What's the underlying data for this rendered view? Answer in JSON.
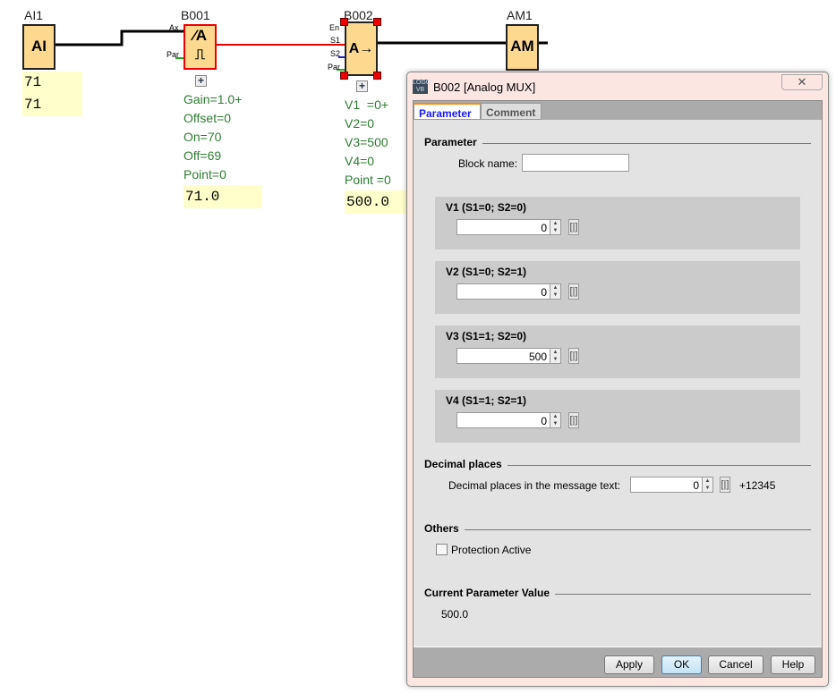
{
  "diagram": {
    "ai1": {
      "label": "AI1",
      "symbol": "AI",
      "values": [
        "71",
        "71"
      ]
    },
    "b001": {
      "label": "B001",
      "symbol": "⁄A",
      "pins": [
        "Ax",
        "Par"
      ],
      "params": [
        "Gain=1.0+",
        "Offset=0",
        "On=70",
        "Off=69",
        "Point=0"
      ],
      "value": "71.0"
    },
    "b002": {
      "label": "B002",
      "symbol": "A→",
      "pins": [
        "En",
        "S1",
        "S2",
        "Par"
      ],
      "params": [
        "V1  =0+",
        "V2=0",
        "V3=500",
        "V4=0",
        "Point =0"
      ],
      "value": "500.0"
    },
    "am1": {
      "label": "AM1",
      "symbol": "AM"
    },
    "expand": "+"
  },
  "dialog": {
    "title": "B002 [Analog MUX]",
    "close": "✕",
    "tabs": [
      {
        "label": "Parameter",
        "active": true
      },
      {
        "label": "Comment"
      }
    ],
    "parameter_section": "Parameter",
    "block_name_label": "Block name:",
    "block_name_value": "",
    "groups": [
      {
        "title": "V1 (S1=0; S2=0)",
        "value": "0"
      },
      {
        "title": "V2 (S1=0; S2=1)",
        "value": "0"
      },
      {
        "title": "V3 (S1=1; S2=0)",
        "value": "500"
      },
      {
        "title": "V4 (S1=1; S2=1)",
        "value": "0"
      }
    ],
    "decimal_section": "Decimal places",
    "decimal_label": "Decimal places in the message text:",
    "decimal_value": "0",
    "decimal_preview": "+12345",
    "others_section": "Others",
    "protection_label": "Protection Active",
    "protection_checked": false,
    "current_section": "Current Parameter Value",
    "current_value": "500.0",
    "buttons": {
      "apply": "Apply",
      "ok": "OK",
      "cancel": "Cancel",
      "help": "Help"
    },
    "bracket": "[|]"
  }
}
